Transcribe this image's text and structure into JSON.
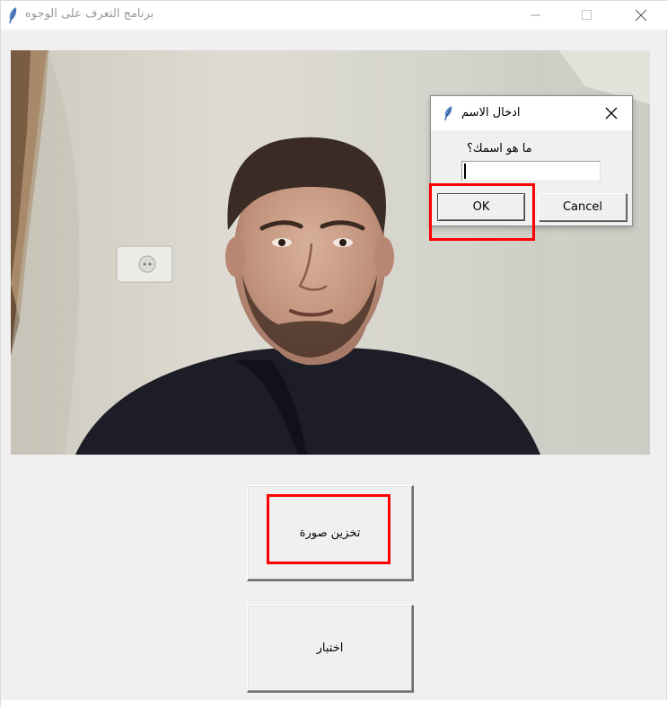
{
  "window": {
    "title": "برنامج التعرف على الوجوه"
  },
  "camera": {
    "description_icon": "webcam-feed"
  },
  "dialog": {
    "title": "ادخال الاسم",
    "prompt": "ما هو اسمك؟",
    "input_value": "",
    "ok_label": "OK",
    "cancel_label": "Cancel"
  },
  "buttons": {
    "save_label": "تخزين صورة",
    "test_label": "اختبار"
  },
  "colors": {
    "highlight": "#ff0000",
    "window_bg": "#f0f0f0"
  }
}
